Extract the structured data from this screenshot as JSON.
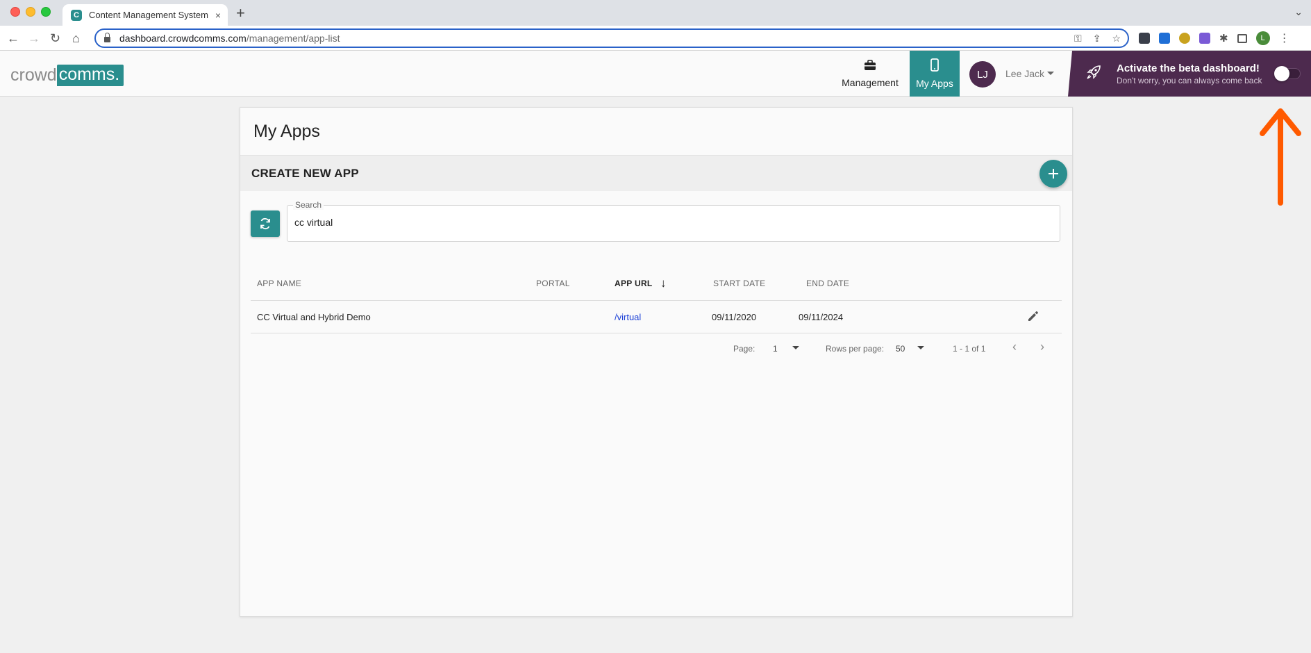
{
  "browser": {
    "tab_title": "Content Management System",
    "tab_close": "×",
    "new_tab": "+",
    "url_host": "dashboard.crowdcomms.com",
    "url_path": "/management/app-list",
    "profile_initial": "L",
    "extensions": [
      "password-icon",
      "share-icon",
      "star-icon",
      "ext-1",
      "ext-2",
      "ext-3",
      "ext-4",
      "puzzle-icon",
      "sidebar-icon"
    ]
  },
  "header": {
    "logo_part1": "crowd",
    "logo_part2": "comms.",
    "nav": [
      {
        "label": "Management",
        "icon": "briefcase-icon"
      },
      {
        "label": "My Apps",
        "icon": "phone-icon"
      }
    ],
    "user": {
      "initials": "LJ",
      "name": "Lee Jack"
    },
    "beta": {
      "title": "Activate the beta dashboard!",
      "subtitle": "Don't worry, you can always come back",
      "enabled": false
    }
  },
  "main": {
    "title": "My Apps",
    "create_label": "CREATE NEW APP",
    "search": {
      "legend": "Search",
      "value": "cc virtual"
    },
    "columns": [
      "APP NAME",
      "PORTAL",
      "APP URL",
      "START DATE",
      "END DATE"
    ],
    "sorted_column": "APP URL",
    "rows": [
      {
        "app_name": "CC Virtual and Hybrid Demo",
        "portal": "",
        "app_url": "/virtual",
        "start_date": "09/11/2020",
        "end_date": "09/11/2024"
      }
    ],
    "pagination": {
      "page_label": "Page:",
      "page_value": "1",
      "rows_label": "Rows per page:",
      "rows_value": "50",
      "range": "1 - 1 of 1"
    }
  },
  "colors": {
    "accent": "#2a8e8e",
    "beta_bg": "#4d2a4e",
    "annotation": "#ff5a00"
  }
}
